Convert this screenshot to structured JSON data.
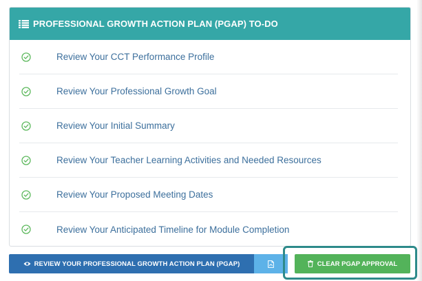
{
  "panel": {
    "title": "PROFESSIONAL GROWTH ACTION PLAN (PGAP) TO-DO",
    "header_icon": "list-icon",
    "items": [
      {
        "label": "Review Your CCT Performance Profile",
        "icon": "check-circle-icon"
      },
      {
        "label": "Review Your Professional Growth Goal",
        "icon": "check-circle-icon"
      },
      {
        "label": "Review Your Initial Summary",
        "icon": "check-circle-icon"
      },
      {
        "label": "Review Your Teacher Learning Activities and Needed Resources",
        "icon": "check-circle-icon"
      },
      {
        "label": "Review Your Proposed Meeting Dates",
        "icon": "check-circle-icon"
      },
      {
        "label": "Review Your Anticipated Timeline for Module Completion",
        "icon": "check-circle-icon"
      }
    ]
  },
  "buttons": {
    "review_label": "REVIEW YOUR PROFESSIONAL GROWTH ACTION PLAN (PGAP)",
    "review_icon": "eye-icon",
    "pdf_icon": "pdf-icon",
    "clear_label": "CLEAR PGAP APPROVAL",
    "clear_icon": "trash-icon"
  },
  "colors": {
    "header": "#35a7a7",
    "check": "#5cb85c",
    "link_text": "#3c6f9c",
    "review_button": "#2e6fb0",
    "pdf_button": "#5db2e8",
    "clear_button": "#53b35a",
    "highlight_outline": "#2d8a8a"
  }
}
